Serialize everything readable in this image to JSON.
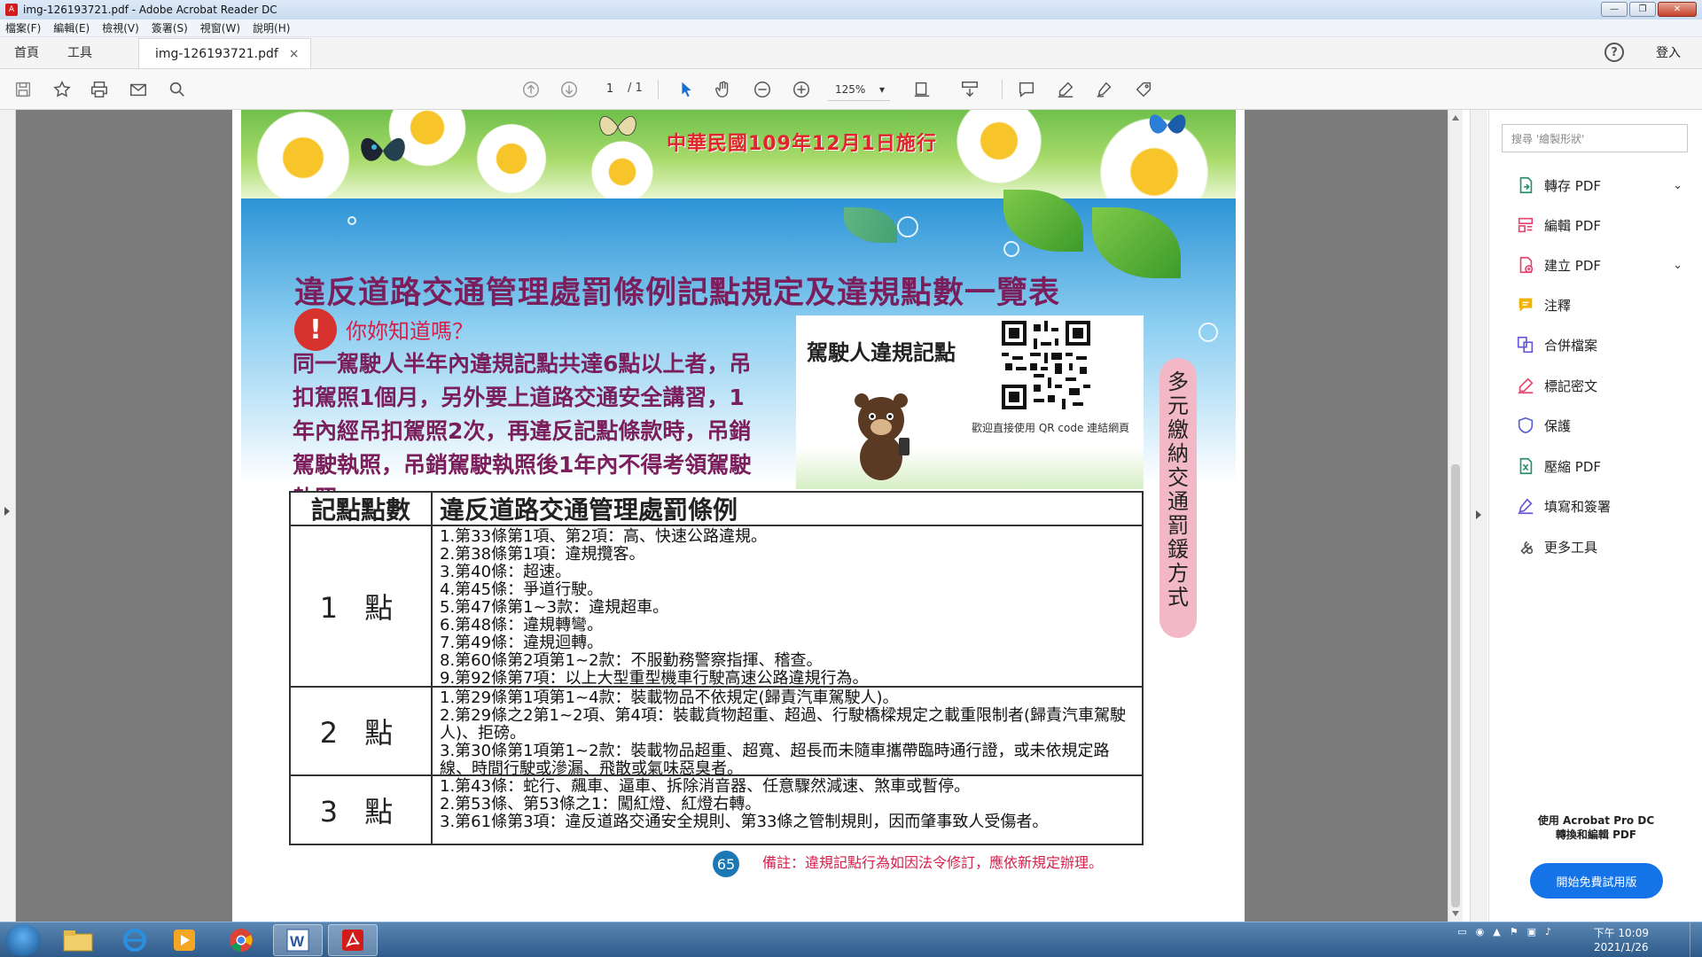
{
  "window": {
    "title": "img-126193721.pdf - Adobe Acrobat Reader DC",
    "minimize": "—",
    "maximize": "❐",
    "close": "✕"
  },
  "menu": [
    "檔案(F)",
    "編輯(E)",
    "檢視(V)",
    "簽署(S)",
    "視窗(W)",
    "說明(H)"
  ],
  "tabs": {
    "home": "首頁",
    "tools": "工具",
    "document": "img-126193721.pdf",
    "close": "×",
    "signin": "登入",
    "help": "?"
  },
  "toolbar": {
    "page_current": "1",
    "page_total": "/ 1",
    "zoom": "125%"
  },
  "doc": {
    "banner_title": "中華民國109年12月1日施行",
    "main_title": "違反道路交通管理處罰條例記點規定及違規點數一覽表",
    "notice_icon": "!",
    "notice_title": "你妳知道嗎？",
    "notice_text": "同一駕駛人半年內違規記點共達6點以上者，吊扣駕照1個月，另外要上道路交通安全講習，1年內經吊扣駕照2次，再違反記點條款時，吊銷駕駛執照，吊銷駕駛執照後1年內不得考領駕駛執照。",
    "qr_label": "駕駛人違規記點",
    "qr_caption": "歡迎直接使用 QR code 連結網頁",
    "side_label": "多元繳納交通罰鍰方式",
    "table_header": [
      "記點點數",
      "違反道路交通管理處罰條例"
    ],
    "rows": [
      {
        "points": "1 點",
        "items": [
          "1.第33條第1項、第2項：高、快速公路違規。",
          "2.第38條第1項：違規攬客。",
          "3.第40條：超速。",
          "4.第45條：爭道行駛。",
          "5.第47條第1~3款：違規超車。",
          "6.第48條：違規轉彎。",
          "7.第49條：違規迴轉。",
          "8.第60條第2項第1~2款：不服勤務警察指揮、稽查。",
          "9.第92條第7項：以上大型重型機車行駛高速公路違規行為。"
        ]
      },
      {
        "points": "2 點",
        "items": [
          "1.第29條第1項第1~4款：裝載物品不依規定(歸責汽車駕駛人)。",
          "2.第29條之2第1~2項、第4項：裝載貨物超重、超過、行駛橋樑規定之載重限制者(歸責汽車駕駛人)、拒磅。",
          "3.第30條第1項第1~2款：裝載物品超重、超寬、超長而未隨車攜帶臨時通行證，或未依規定路線、時間行駛或滲漏、飛散或氣味惡臭者。"
        ]
      },
      {
        "points": "3 點",
        "items": [
          "1.第43條：蛇行、飆車、逼車、拆除消音器、任意驟然減速、煞車或暫停。",
          "2.第53條、第53條之1：闖紅燈、紅燈右轉。",
          "3.第61條第3項：違反道路交通安全規則、第33條之管制規則，因而肇事致人受傷者。"
        ]
      }
    ],
    "page_number": "65",
    "remark": "備註：違規記點行為如因法令修訂，應依新規定辦理。"
  },
  "panel": {
    "search_placeholder": "搜尋 '繪製形狀'",
    "tools": [
      {
        "label": "轉存 PDF",
        "icon": "export-pdf-icon",
        "color": "#2a8f6c",
        "chevron": true
      },
      {
        "label": "編輯 PDF",
        "icon": "edit-pdf-icon",
        "color": "#e5466d",
        "chevron": false
      },
      {
        "label": "建立 PDF",
        "icon": "create-pdf-icon",
        "color": "#e5466d",
        "chevron": true
      },
      {
        "label": "注釋",
        "icon": "comment-icon",
        "color": "#f0b400",
        "chevron": false
      },
      {
        "label": "合併檔案",
        "icon": "combine-files-icon",
        "color": "#6657d6",
        "chevron": false
      },
      {
        "label": "標記密文",
        "icon": "redact-icon",
        "color": "#e5466d",
        "chevron": false
      },
      {
        "label": "保護",
        "icon": "protect-icon",
        "color": "#5960d6",
        "chevron": false
      },
      {
        "label": "壓縮 PDF",
        "icon": "compress-pdf-icon",
        "color": "#2a8f6c",
        "chevron": false
      },
      {
        "label": "填寫和簽署",
        "icon": "fill-sign-icon",
        "color": "#6657d6",
        "chevron": false
      },
      {
        "label": "更多工具",
        "icon": "more-tools-icon",
        "color": "#555555",
        "chevron": false
      }
    ],
    "promo_line1": "使用 Acrobat Pro DC",
    "promo_line2": "轉換和編輯 PDF",
    "trial_button": "開始免費試用版"
  },
  "taskbar": {
    "time": "下午 10:09",
    "date": "2021/1/26"
  }
}
